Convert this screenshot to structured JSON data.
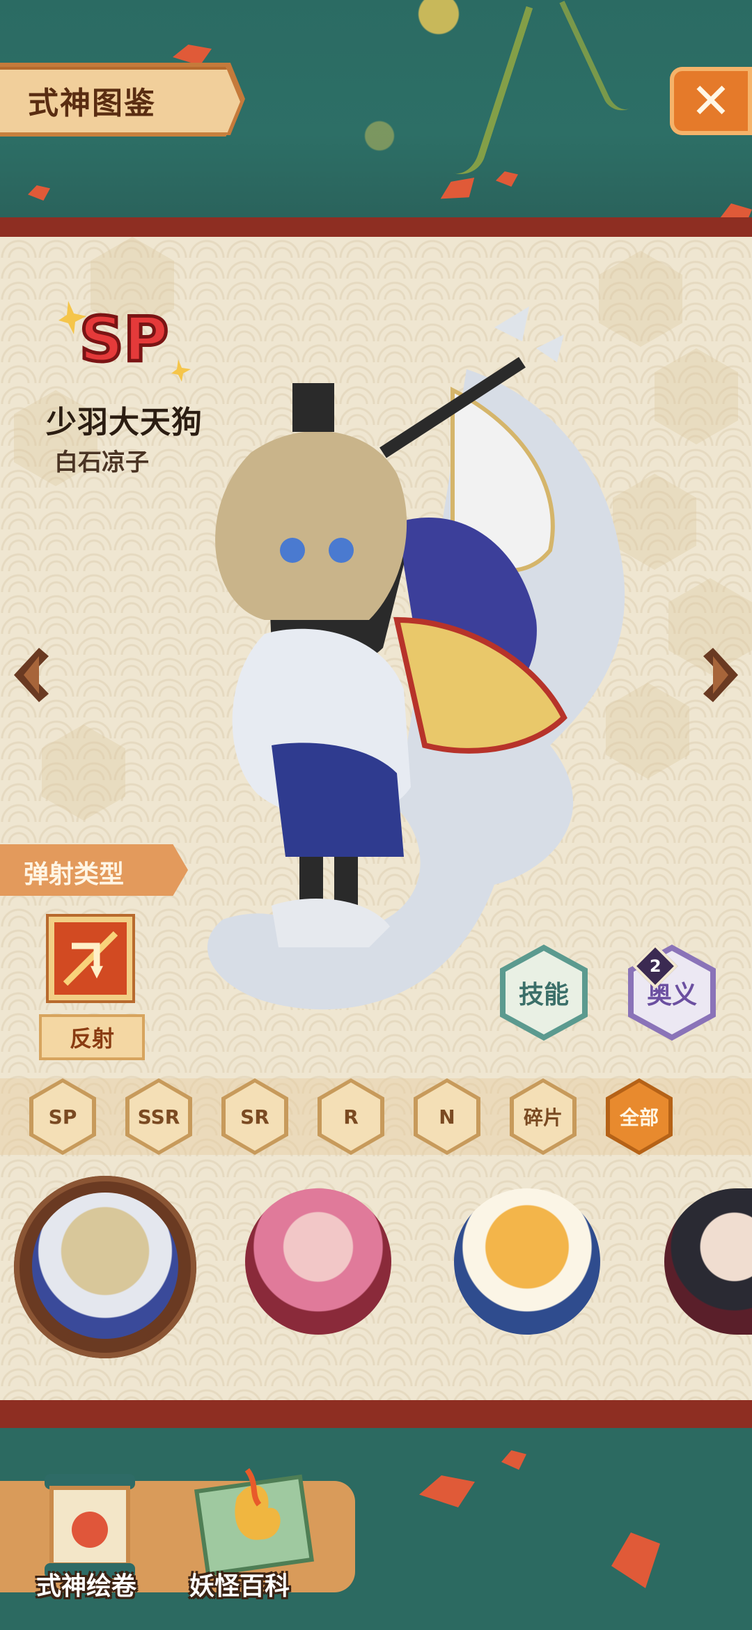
{
  "header": {
    "title": "式神图鉴",
    "close_label": "✕"
  },
  "shikigami": {
    "rarity": "SP",
    "name": "少羽大天狗",
    "voice_actor": "白石凉子"
  },
  "attack_type": {
    "title": "弹射类型",
    "value": "反射"
  },
  "actions": {
    "skill_label": "技能",
    "ougi_label": "奥义",
    "ougi_count": "2"
  },
  "filters": [
    {
      "label": "SP",
      "active": false
    },
    {
      "label": "SSR",
      "active": false
    },
    {
      "label": "SR",
      "active": false
    },
    {
      "label": "R",
      "active": false
    },
    {
      "label": "N",
      "active": false
    },
    {
      "label": "碎片",
      "active": false
    },
    {
      "label": "全部",
      "active": true
    }
  ],
  "bottom_nav": [
    {
      "label": "式神绘卷"
    },
    {
      "label": "妖怪百科"
    }
  ],
  "colors": {
    "panel_border": "#8e2e22",
    "accent_orange": "#e57a2a",
    "teal_background": "#2f6b62"
  }
}
